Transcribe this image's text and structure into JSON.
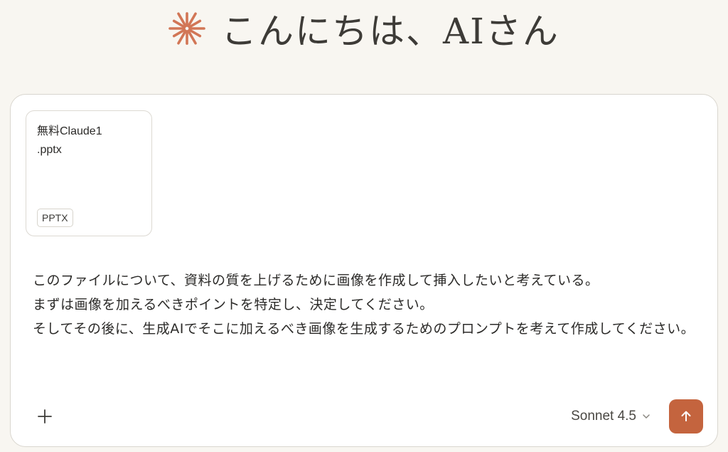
{
  "greeting": {
    "icon": "asterisk-spark-icon",
    "text": "こんにちは、AIさん"
  },
  "composer": {
    "attachment": {
      "file_name": "無料Claude1\n.pptx",
      "file_type": "PPTX"
    },
    "prompt_text": "このファイルについて、資料の質を上げるために画像を作成して挿入したいと考えている。\nまずは画像を加えるべきポイントを特定し、決定してください。\nそしてその後に、生成AIでそこに加えるべき画像を生成するためのプロンプトを考えて作成してください。",
    "add_icon": "plus-icon",
    "model": {
      "label": "Sonnet 4.5",
      "icon": "chevron-down-icon"
    },
    "send": {
      "icon": "arrow-up-icon"
    }
  },
  "colors": {
    "background": "#f8f6f1",
    "accent": "#c4643e",
    "spark": "#d27656",
    "composer_bg": "#ffffff",
    "border": "#d9d6cf"
  }
}
